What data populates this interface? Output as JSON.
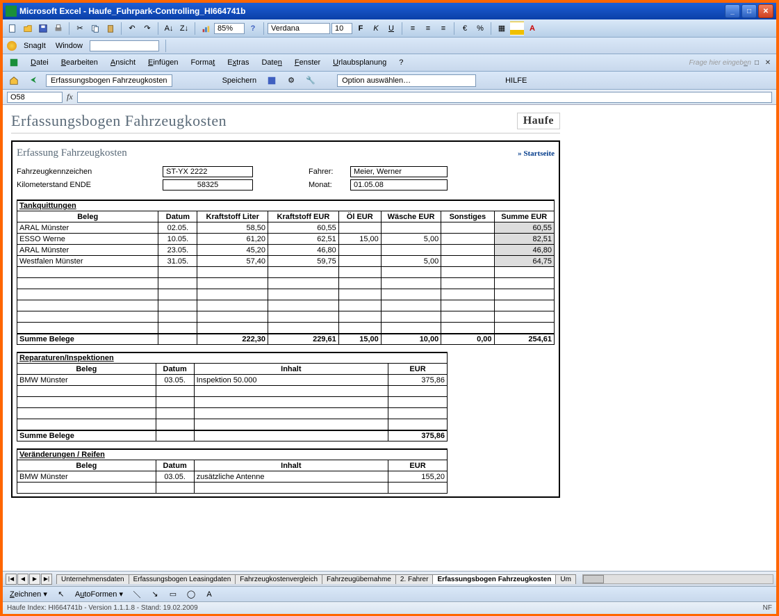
{
  "window": {
    "app": "Microsoft Excel",
    "doc": "Haufe_Fuhrpark-Controlling_HI664741b"
  },
  "toolbar": {
    "zoom": "85%",
    "font": "Verdana",
    "fontsize": "10",
    "currency": "€"
  },
  "snagit": {
    "label": "SnagIt",
    "window": "Window"
  },
  "menu": {
    "datei": "Datei",
    "bearbeiten": "Bearbeiten",
    "ansicht": "Ansicht",
    "einfuegen": "Einfügen",
    "format": "Format",
    "extras": "Extras",
    "daten": "Daten",
    "fenster": "Fenster",
    "urlaubsplanung": "Urlaubsplanung",
    "help": "?"
  },
  "askbox": "Frage hier eingeben",
  "custombar": {
    "field1": "Erfassungsbogen Fahrzeugkosten",
    "speichern": "Speichern",
    "option": "Option auswählen…",
    "hilfe": "HILFE"
  },
  "namebox": "O58",
  "page": {
    "title": "Erfassungsbogen Fahrzeugkosten",
    "logo": "Haufe",
    "subtitle": "Erfassung Fahrzeugkosten",
    "startseite": "» Startseite",
    "fields": {
      "kennzeichen_label": "Fahrzeugkennzeichen",
      "kennzeichen_val": "ST-YX 2222",
      "km_label": "Kilometerstand ENDE",
      "km_val": "58325",
      "fahrer_label": "Fahrer:",
      "fahrer_val": "Meier, Werner",
      "monat_label": "Monat:",
      "monat_val": "01.05.08"
    },
    "tank": {
      "section": "Tankquittungen",
      "headers": [
        "Beleg",
        "Datum",
        "Kraftstoff Liter",
        "Kraftstoff EUR",
        "Öl EUR",
        "Wäsche EUR",
        "Sonstiges",
        "Summe EUR"
      ],
      "rows": [
        {
          "beleg": "ARAL Münster",
          "datum": "02.05.",
          "liter": "58,50",
          "keur": "60,55",
          "oel": "",
          "wash": "",
          "sonst": "",
          "sum": "60,55"
        },
        {
          "beleg": "ESSO Werne",
          "datum": "10.05.",
          "liter": "61,20",
          "keur": "62,51",
          "oel": "15,00",
          "wash": "5,00",
          "sonst": "",
          "sum": "82,51"
        },
        {
          "beleg": "ARAL Münster",
          "datum": "23.05.",
          "liter": "45,20",
          "keur": "46,80",
          "oel": "",
          "wash": "",
          "sonst": "",
          "sum": "46,80"
        },
        {
          "beleg": "Westfalen Münster",
          "datum": "31.05.",
          "liter": "57,40",
          "keur": "59,75",
          "oel": "",
          "wash": "5,00",
          "sonst": "",
          "sum": "64,75"
        }
      ],
      "total_label": "Summe Belege",
      "totals": {
        "liter": "222,30",
        "keur": "229,61",
        "oel": "15,00",
        "wash": "10,00",
        "sonst": "0,00",
        "sum": "254,61"
      }
    },
    "rep": {
      "section": "Reparaturen/Inspektionen",
      "headers": [
        "Beleg",
        "Datum",
        "Inhalt",
        "EUR"
      ],
      "rows": [
        {
          "beleg": "BMW Münster",
          "datum": "03.05.",
          "inhalt": "Inspektion 50.000",
          "eur": "375,86"
        }
      ],
      "total_label": "Summe Belege",
      "total": "375,86"
    },
    "ver": {
      "section": "Veränderungen / Reifen",
      "headers": [
        "Beleg",
        "Datum",
        "Inhalt",
        "EUR"
      ],
      "rows": [
        {
          "beleg": "BMW Münster",
          "datum": "03.05.",
          "inhalt": "zusätzliche Antenne",
          "eur": "155,20"
        }
      ]
    }
  },
  "tabs": {
    "items": [
      "Unternehmensdaten",
      "Erfassungsbogen Leasingdaten",
      "Fahrzeugkostenvergleich",
      "Fahrzeugübernahme",
      "2. Fahrer",
      "Erfassungsbogen Fahrzeugkosten",
      "Um"
    ],
    "active": 5
  },
  "drawbar": {
    "zeichnen": "Zeichnen",
    "autoformen": "AutoFormen"
  },
  "statusbar": {
    "left": "Haufe Index: HI664741b - Version 1.1.1.8 - Stand: 19.02.2009",
    "right": "NF"
  }
}
